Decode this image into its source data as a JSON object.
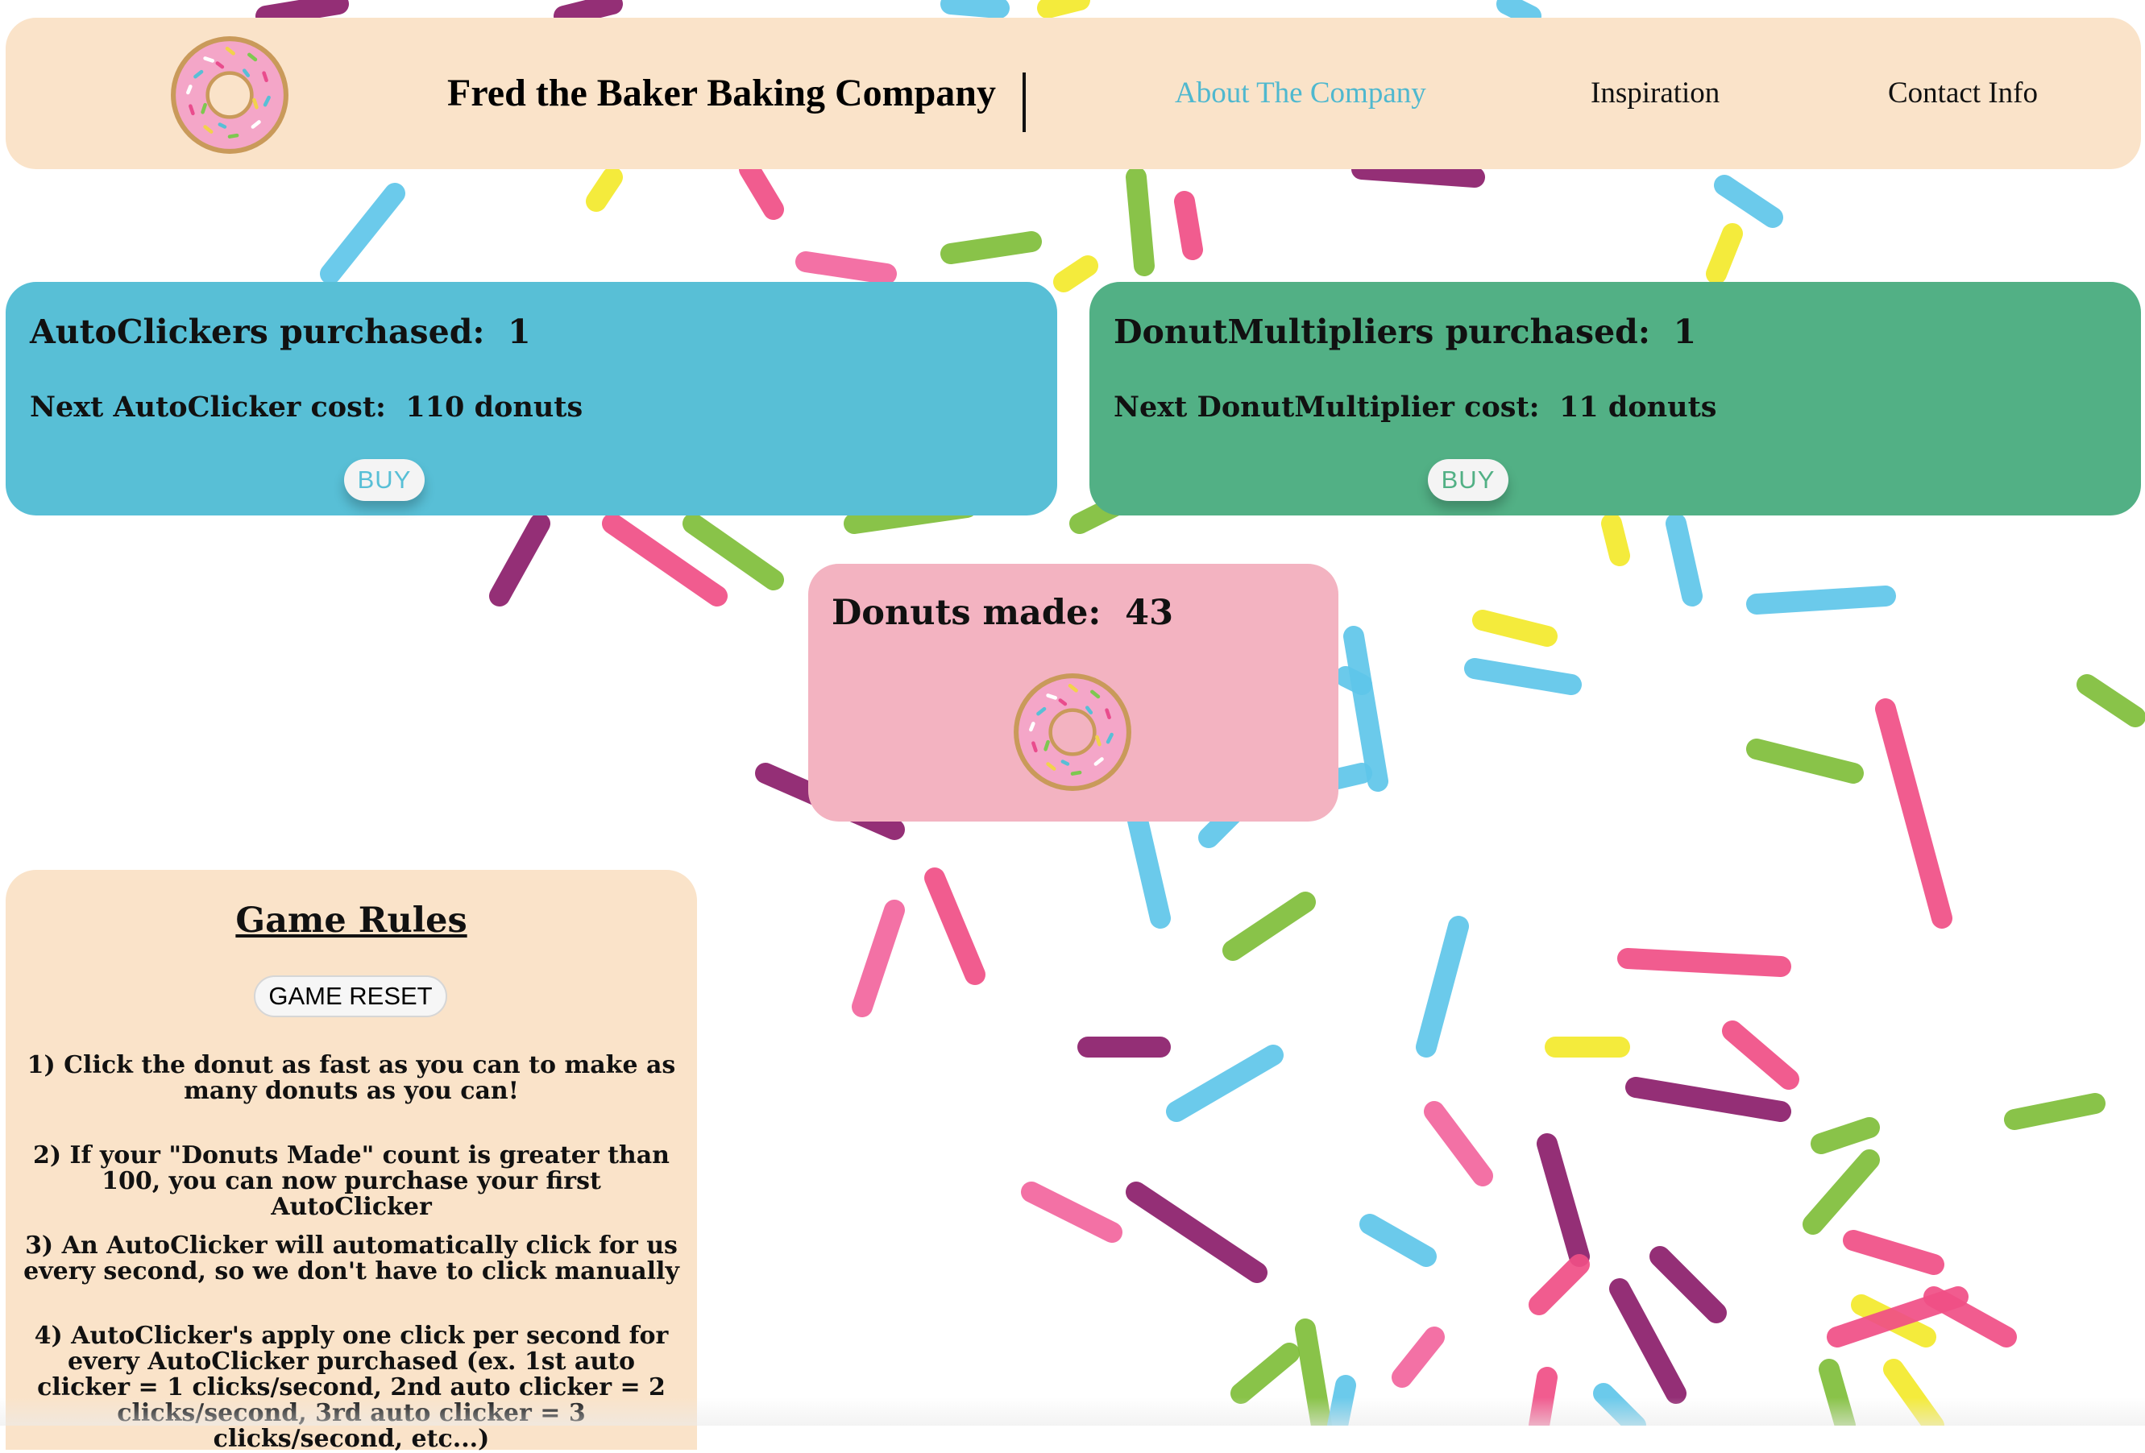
{
  "header": {
    "title": "Fred the Baker Baking Company",
    "nav": [
      {
        "label": "About The Company"
      },
      {
        "label": "Inspiration"
      },
      {
        "label": "Contact Info"
      }
    ]
  },
  "autoclicker": {
    "purchased_label": "AutoClickers purchased:",
    "purchased_count": "1",
    "cost_label": "Next AutoClicker cost:",
    "cost_value": "110 donuts",
    "buy_label": "BUY"
  },
  "multiplier": {
    "purchased_label": "DonutMultipliers purchased:",
    "purchased_count": "1",
    "cost_label": "Next DonutMultiplier cost:",
    "cost_value": "11 donuts",
    "buy_label": "BUY"
  },
  "donuts": {
    "label": "Donuts made:",
    "count": "43"
  },
  "rules": {
    "title": "Game Rules",
    "reset_label": "GAME RESET",
    "items": [
      "1) Click the donut as fast as you can to make as many donuts as you can!",
      "2) If your \"Donuts Made\" count is greater than 100, you can now purchase your first AutoClicker",
      "3) An AutoClicker will automatically click for us every second, so we don't have to click manually",
      "4) AutoClicker's apply one click per second for every AutoClicker purchased (ex. 1st auto clicker = 1 clicks/second, 2nd auto clicker = 2 clicks/second, 3rd auto clicker = 3 clicks/second, etc...)"
    ]
  },
  "icons": {
    "logo": "donut-icon",
    "clickable_donut": "donut-icon"
  },
  "colors": {
    "header_bg": "#fae3c9",
    "autoclicker_panel": "#58bfd6",
    "multiplier_panel": "#52b085",
    "donut_panel": "#f3b3c1",
    "rules_panel": "#fae3c9",
    "active_nav": "#4fb8cf"
  }
}
